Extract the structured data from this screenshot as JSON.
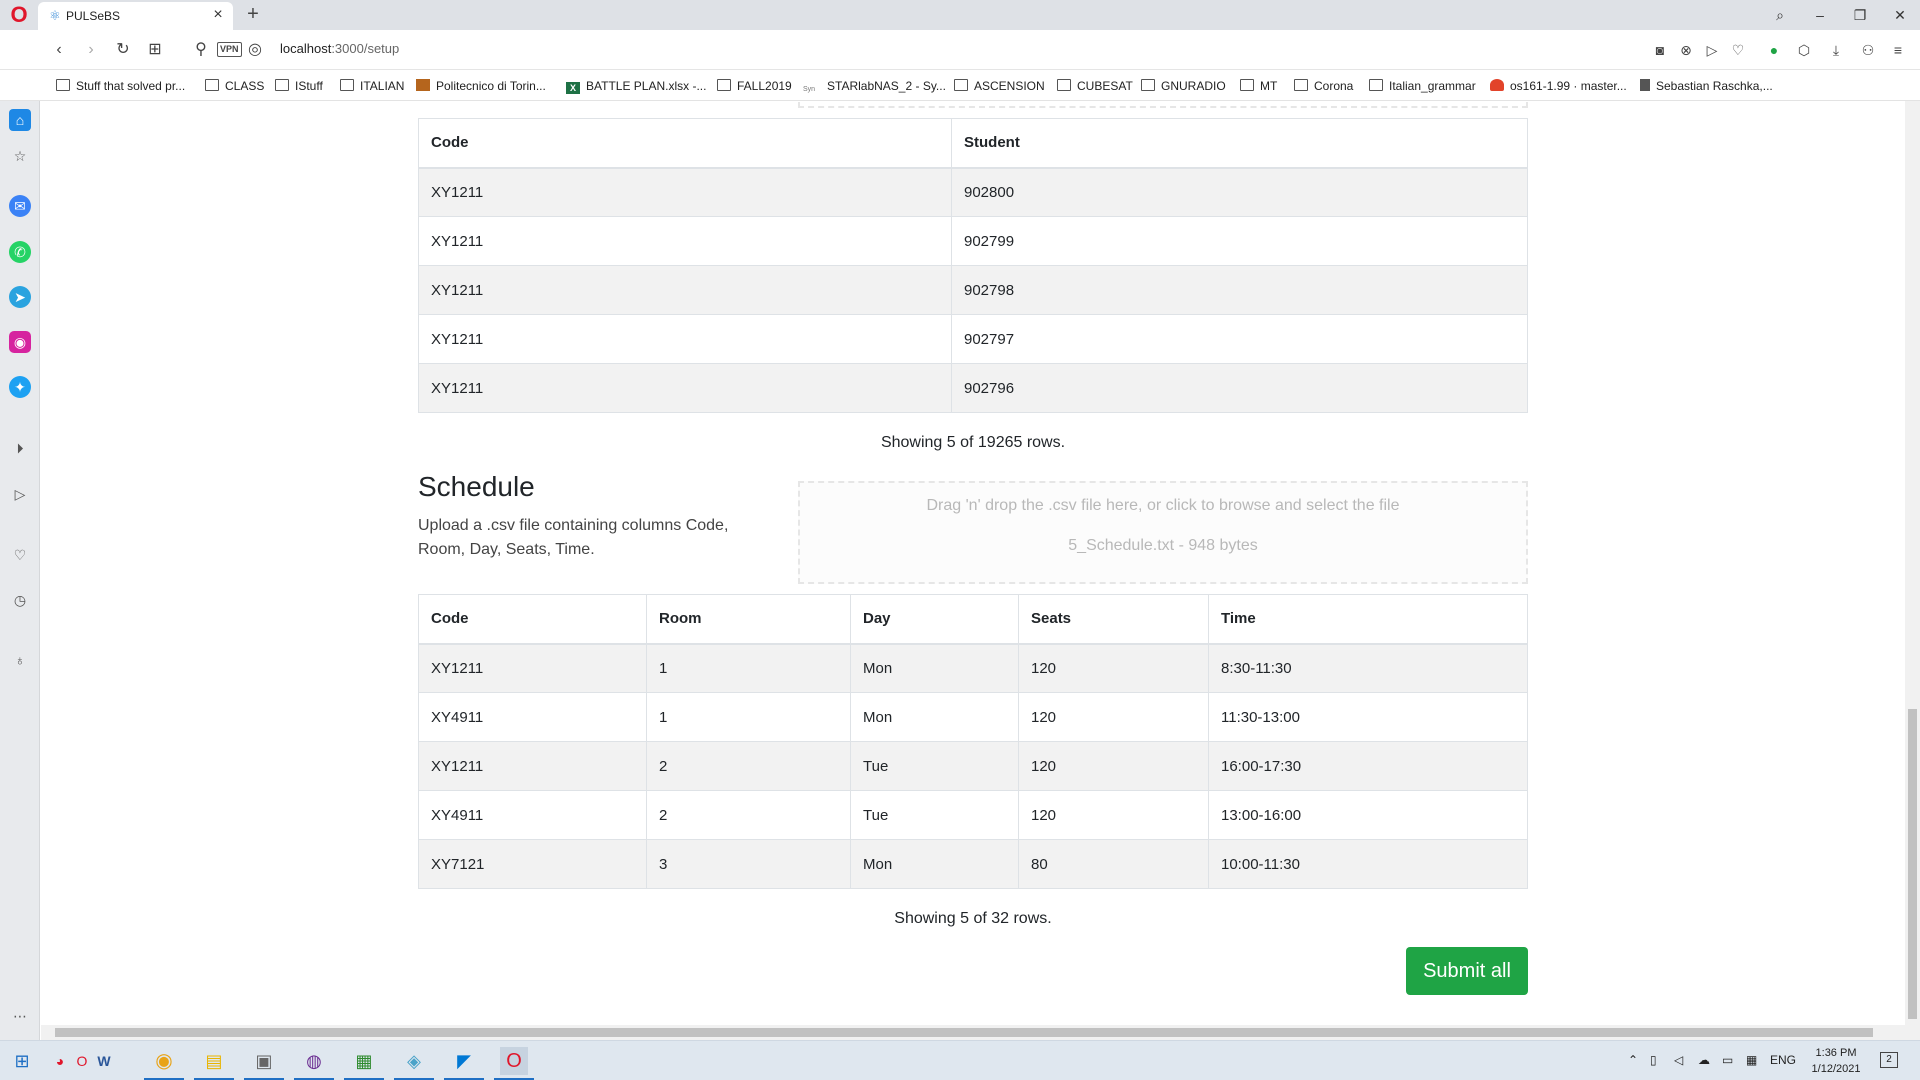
{
  "browser": {
    "tab_title": "PULSeBS",
    "url_host": "localhost",
    "url_path": ":3000/setup",
    "vpn_label": "VPN"
  },
  "bookmarks": [
    "Stuff that solved pr...",
    "CLASS",
    "IStuff",
    "ITALIAN",
    "Politecnico di Torin...",
    "BATTLE PLAN.xlsx -...",
    "FALL2019",
    "STARlabNAS_2 - Sy...",
    "ASCENSION",
    "CUBESAT",
    "GNURADIO",
    "MT",
    "Corona",
    "Italian_grammar",
    "os161-1.99 · master...",
    "Sebastian Raschka,..."
  ],
  "enrollment": {
    "columns": [
      "Code",
      "Student"
    ],
    "rows": [
      [
        "XY1211",
        "902800"
      ],
      [
        "XY1211",
        "902799"
      ],
      [
        "XY1211",
        "902798"
      ],
      [
        "XY1211",
        "902797"
      ],
      [
        "XY1211",
        "902796"
      ]
    ],
    "showing": "Showing 5 of 19265 rows."
  },
  "schedule": {
    "title": "Schedule",
    "description": "Upload a .csv file containing columns Code, Room, Day, Seats, Time.",
    "dropzone_hint": "Drag 'n' drop the .csv file here, or click to browse and select the file",
    "dropzone_file": "5_Schedule.txt - 948 bytes",
    "columns": [
      "Code",
      "Room",
      "Day",
      "Seats",
      "Time"
    ],
    "rows": [
      [
        "XY1211",
        "1",
        "Mon",
        "120",
        "8:30-11:30"
      ],
      [
        "XY4911",
        "1",
        "Mon",
        "120",
        "11:30-13:00"
      ],
      [
        "XY1211",
        "2",
        "Tue",
        "120",
        "16:00-17:30"
      ],
      [
        "XY4911",
        "2",
        "Tue",
        "120",
        "13:00-16:00"
      ],
      [
        "XY7121",
        "3",
        "Mon",
        "80",
        "10:00-11:30"
      ]
    ],
    "showing": "Showing 5 of 32 rows."
  },
  "submit_label": "Submit all",
  "taskbar": {
    "lang": "ENG",
    "time": "1:36 PM",
    "date": "1/12/2021",
    "notifications": "2"
  },
  "colors": {
    "submit": "#1fa445",
    "opera": "#e0162b",
    "row_stripe": "#f2f2f2"
  }
}
